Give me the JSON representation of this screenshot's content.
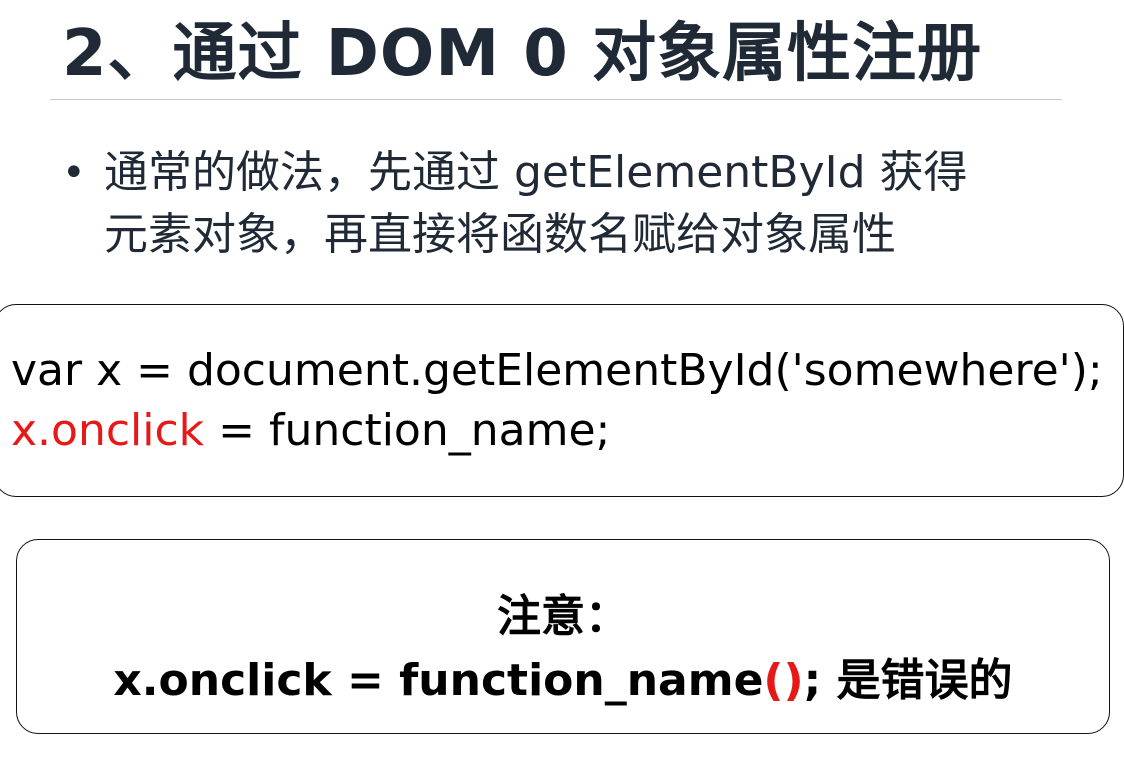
{
  "title": "2、通过 DOM 0 对象属性注册",
  "bullet": {
    "dot": "•",
    "line1": "通常的做法，先通过 getElementById 获得",
    "line2": "元素对象，再直接将函数名赋给对象属性"
  },
  "code": {
    "line1": "var x = document.getElementById('somewhere');",
    "line2_red": "x.onclick",
    "line2_rest": " = function_name;"
  },
  "note": {
    "title": "注意：",
    "body_start": "x.onclick = function_name",
    "body_parens": "()",
    "body_end": "; 是错误的"
  },
  "colors": {
    "title": "#1f2a36",
    "highlight": "#e61919"
  }
}
